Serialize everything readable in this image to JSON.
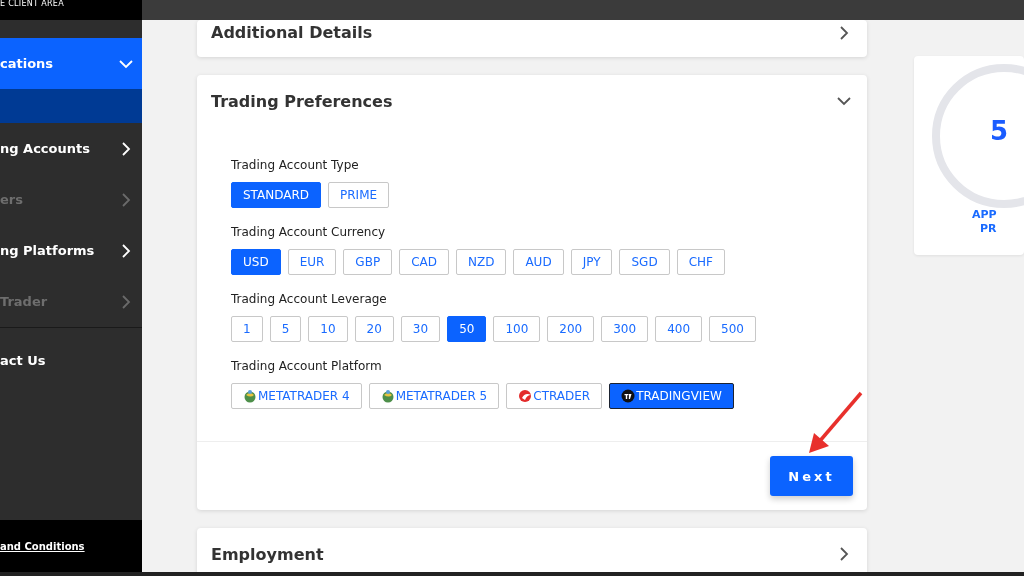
{
  "sidebar": {
    "header": "E CLIENT AREA",
    "items": [
      {
        "label": "cations",
        "expanded": true,
        "disabled": false,
        "children": [
          {
            "selected": true
          }
        ]
      },
      {
        "label": "ng Accounts",
        "expanded": false,
        "disabled": false
      },
      {
        "label": "ers",
        "expanded": false,
        "disabled": true
      },
      {
        "label": "ng Platforms",
        "expanded": false,
        "disabled": false
      },
      {
        "label": "Trader",
        "expanded": false,
        "disabled": true
      }
    ],
    "contact": "act Us",
    "footer_link": "and Conditions"
  },
  "sections": [
    {
      "title": "Additional Details",
      "expanded": false
    },
    {
      "title": "Trading Preferences",
      "expanded": true,
      "groups": [
        {
          "label": "Trading Account Type",
          "options": [
            {
              "label": "STANDARD",
              "selected": true
            },
            {
              "label": "PRIME",
              "selected": false
            }
          ]
        },
        {
          "label": "Trading Account Currency",
          "options": [
            {
              "label": "USD",
              "selected": true
            },
            {
              "label": "EUR",
              "selected": false
            },
            {
              "label": "GBP",
              "selected": false
            },
            {
              "label": "CAD",
              "selected": false
            },
            {
              "label": "NZD",
              "selected": false
            },
            {
              "label": "AUD",
              "selected": false
            },
            {
              "label": "JPY",
              "selected": false
            },
            {
              "label": "SGD",
              "selected": false
            },
            {
              "label": "CHF",
              "selected": false
            }
          ]
        },
        {
          "label": "Trading Account Leverage",
          "options": [
            {
              "label": "1",
              "selected": false
            },
            {
              "label": "5",
              "selected": false
            },
            {
              "label": "10",
              "selected": false
            },
            {
              "label": "20",
              "selected": false
            },
            {
              "label": "30",
              "selected": false
            },
            {
              "label": "50",
              "selected": true
            },
            {
              "label": "100",
              "selected": false
            },
            {
              "label": "200",
              "selected": false
            },
            {
              "label": "300",
              "selected": false
            },
            {
              "label": "400",
              "selected": false
            },
            {
              "label": "500",
              "selected": false
            }
          ]
        },
        {
          "label": "Trading Account Platform",
          "options": [
            {
              "label": "METATRADER 4",
              "selected": false,
              "kind": "metatrader"
            },
            {
              "label": "METATRADER 5",
              "selected": false,
              "kind": "metatrader"
            },
            {
              "label": "CTRADER",
              "selected": false,
              "kind": "ctrader"
            },
            {
              "label": "TRADINGVIEW",
              "selected": true,
              "kind": "tradingview"
            }
          ]
        }
      ],
      "button": "Next"
    },
    {
      "title": "Employment",
      "expanded": false
    }
  ],
  "progress": {
    "value": "5",
    "caption_lines": [
      "APP",
      "PR"
    ]
  }
}
